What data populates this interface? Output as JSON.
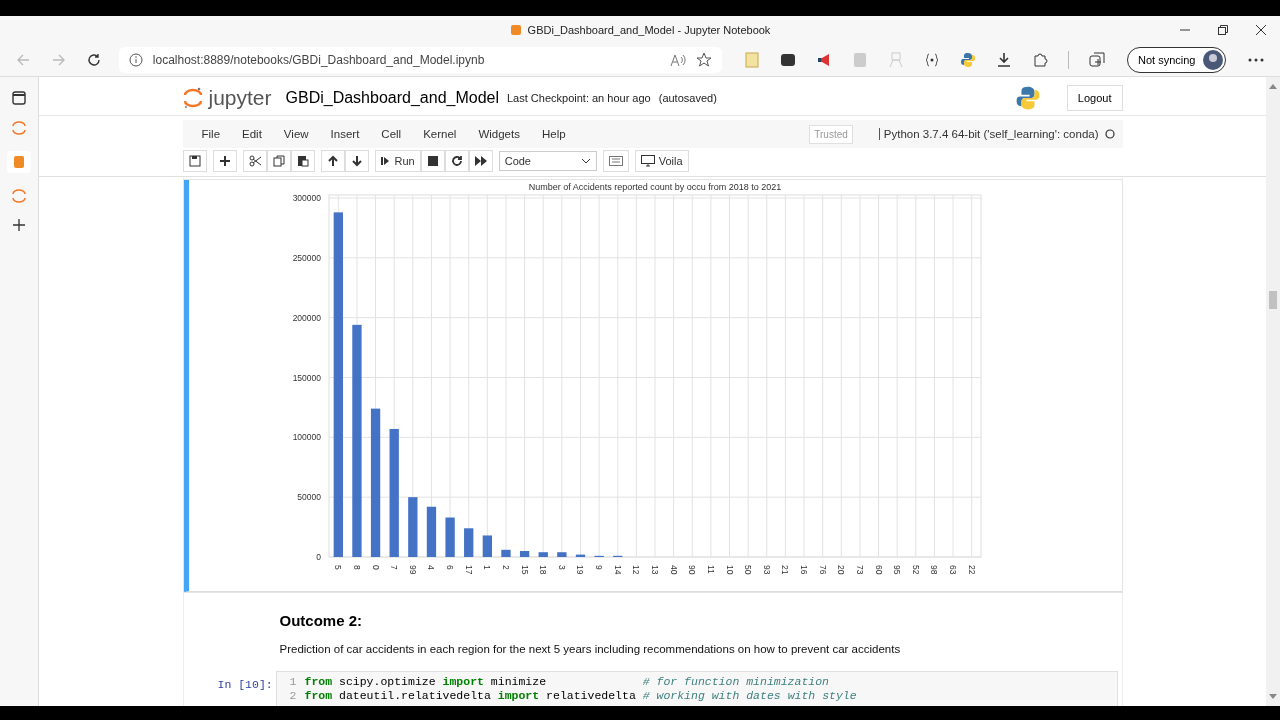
{
  "browser": {
    "tab_title": "GBDi_Dashboard_and_Model - Jupyter Notebook",
    "url": "localhost:8889/notebooks/GBDi_Dashboard_and_Model.ipynb",
    "sync_label": "Not syncing"
  },
  "notebook": {
    "brand": "jupyter",
    "name": "GBDi_Dashboard_and_Model",
    "checkpoint": "Last Checkpoint: an hour ago",
    "autosaved": "(autosaved)",
    "logout": "Logout",
    "menu": [
      "File",
      "Edit",
      "View",
      "Insert",
      "Cell",
      "Kernel",
      "Widgets",
      "Help"
    ],
    "trusted": "Trusted",
    "kernel": "Python 3.7.4 64-bit ('self_learning': conda)",
    "toolbar": {
      "run": "Run",
      "cell_type": "Code",
      "voila": "Voila"
    }
  },
  "output": {
    "chart_data": {
      "type": "bar",
      "title": "Number of Accidents reported count by occu from 2018 to 2021",
      "categories": [
        "5",
        "8",
        "0",
        "7",
        "99",
        "4",
        "6",
        "17",
        "1",
        "2",
        "15",
        "18",
        "3",
        "19",
        "9",
        "14",
        "12",
        "13",
        "40",
        "90",
        "11",
        "10",
        "50",
        "93",
        "21",
        "16",
        "76",
        "20",
        "73",
        "60",
        "95",
        "52",
        "98",
        "63",
        "22"
      ],
      "grid": true,
      "series": [
        {
          "color": "#4472c4",
          "values": [
            288000,
            194000,
            124000,
            107000,
            50000,
            42000,
            33000,
            24000,
            18000,
            6000,
            5000,
            4000,
            4000,
            2000,
            1000,
            1000,
            0,
            0,
            0,
            0,
            0,
            0,
            0,
            0,
            0,
            0,
            0,
            0,
            0,
            0,
            0,
            0,
            0,
            0,
            0
          ]
        }
      ],
      "ylim": [
        0,
        300000
      ],
      "yticks": [
        0,
        50000,
        100000,
        150000,
        200000,
        250000,
        300000
      ]
    }
  },
  "outcome": {
    "heading": "Outcome 2:",
    "text": "Prediction of car accidents in each region for the next 5 years including recommendations on how to prevent car accidents"
  },
  "code_cell": {
    "prompt": "In [10]:",
    "lines": [
      {
        "number": "1",
        "tokens": [
          {
            "kind": "keyword",
            "text": "from"
          },
          {
            "kind": "plain",
            "text": " scipy.optimize "
          },
          {
            "kind": "keyword",
            "text": "import"
          },
          {
            "kind": "plain",
            "text": " minimize              "
          },
          {
            "kind": "comment",
            "text": "# for function minimization"
          }
        ]
      },
      {
        "number": "2",
        "tokens": [
          {
            "kind": "keyword",
            "text": "from"
          },
          {
            "kind": "plain",
            "text": " dateutil.relativedelta "
          },
          {
            "kind": "keyword",
            "text": "import"
          },
          {
            "kind": "plain",
            "text": " relativedelta "
          },
          {
            "kind": "comment",
            "text": "# working with dates with style"
          }
        ]
      }
    ]
  }
}
